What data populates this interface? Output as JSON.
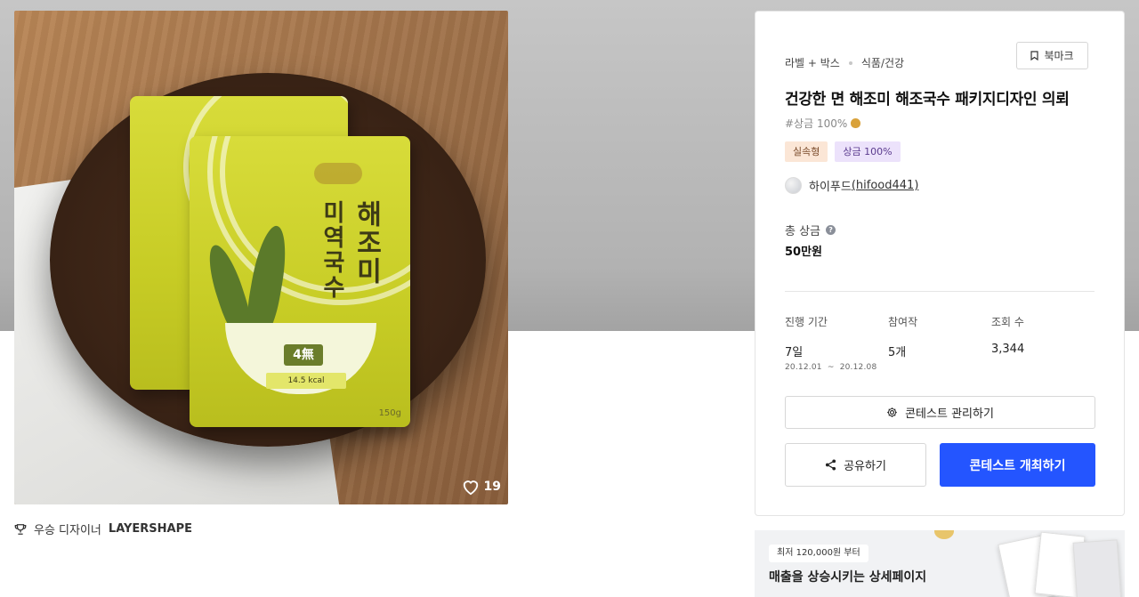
{
  "product_image": {
    "alt": "건강한 면 해조미 미역국수 패키지",
    "pack_text_main": "해조미",
    "pack_text_sub": "미역국수",
    "pack_badge": "4無",
    "pack_kcal": "14.5 kcal",
    "pack_weight": "150g",
    "likes": "19"
  },
  "award": {
    "prefix": "우승 디자이너",
    "designer": "LAYERSHAPE"
  },
  "contest": {
    "category": "라벨 + 박스",
    "subcategory": "식품/건강",
    "bookmark_label": "북마크",
    "title": "건강한 면 해조미 해조국수 패키지디자인 의뢰",
    "hashtag": "#상금 100%",
    "tags": [
      "실속형",
      "상금 100%"
    ],
    "host_name": "하이푸드",
    "host_handle": "(hifood441)",
    "prize_label": "총 상금",
    "prize_value": "50만원",
    "stats": {
      "duration_label": "진행 기간",
      "duration_value": "7일",
      "duration_start": "20.12.01",
      "duration_sep": "~",
      "duration_end": "20.12.08",
      "entries_label": "참여작",
      "entries_value": "5개",
      "views_label": "조회 수",
      "views_value": "3,344"
    },
    "manage_label": "콘테스트 관리하기",
    "share_label": "공유하기",
    "host_contest_label": "콘테스트 개최하기"
  },
  "banner": {
    "pill": "최저 120,000원 부터",
    "headline": "매출을 상승시키는 상세페이지"
  },
  "colors": {
    "primary": "#2455ff",
    "pack_yellow": "#d8dc3a"
  }
}
